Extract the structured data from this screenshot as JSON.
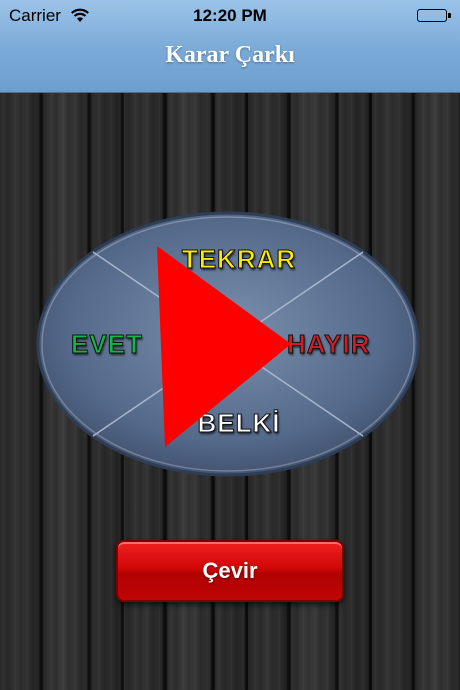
{
  "status_bar": {
    "carrier": "Carrier",
    "time": "12:20 PM",
    "wifi_icon": "wifi-icon",
    "battery_icon": "battery-full-icon"
  },
  "nav": {
    "title": "Karar Çarkı"
  },
  "wheel": {
    "segments": {
      "top": "TEKRAR",
      "left": "EVET",
      "right": "HAYIR",
      "bottom": "BELKİ"
    },
    "colors": {
      "top": "#ffec00",
      "left": "#14b64a",
      "right": "#ce1f26",
      "bottom": "#ffffff",
      "pointer": "#ff0000"
    },
    "pointer_icon": "play-arrow-icon"
  },
  "actions": {
    "spin_label": "Çevir",
    "spin_color": "#d10707"
  }
}
